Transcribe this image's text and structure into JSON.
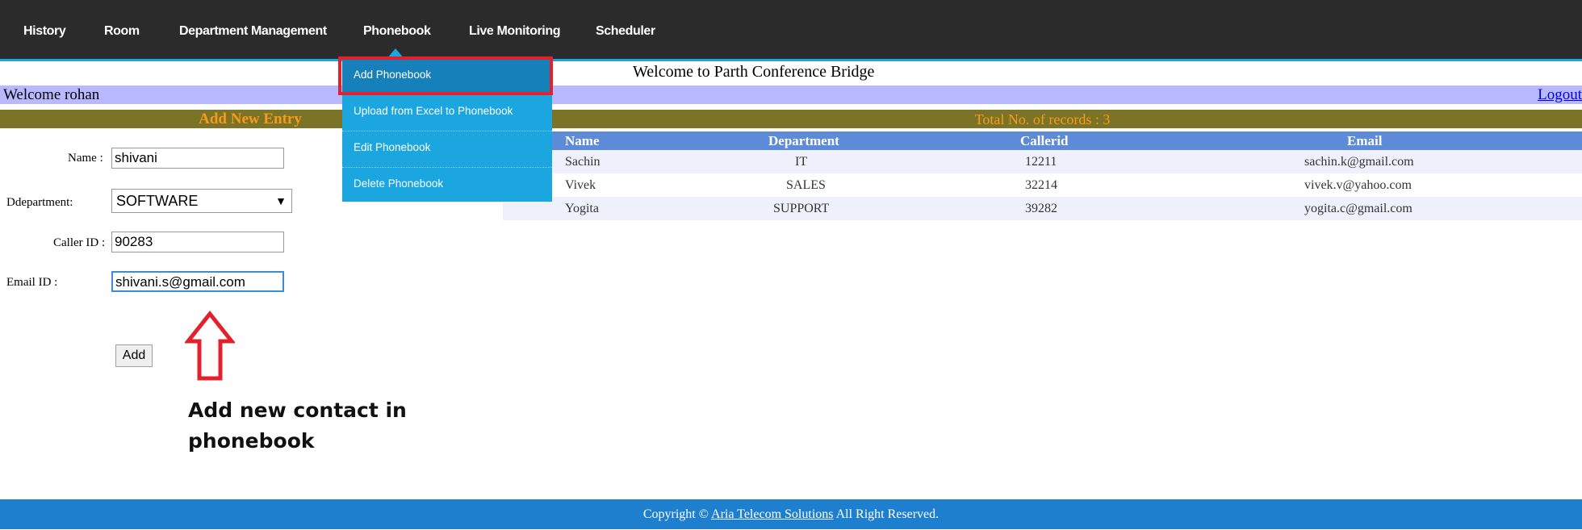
{
  "nav": {
    "items": [
      "History",
      "Room",
      "Department Management",
      "Phonebook",
      "Live Monitoring",
      "Scheduler"
    ]
  },
  "dropdown": {
    "items": [
      "Add Phonebook",
      "Upload from Excel to Phonebook",
      "Edit Phonebook",
      "Delete Phonebook"
    ]
  },
  "page_title": "Welcome to Parth Conference Bridge",
  "welcome_user": "Welcome  rohan",
  "logout": "Logout",
  "form": {
    "title": "Add New Entry",
    "name_label": "Name :",
    "name_value": "shivani",
    "department_label": "Ddepartment:",
    "department_value": "SOFTWARE",
    "callerid_label": "Caller ID :",
    "callerid_value": "90283",
    "email_label": "Email ID :",
    "email_value": "shivani.s@gmail.com",
    "add_button": "Add"
  },
  "annotation": {
    "line1": "Add new contact in",
    "line2": "phonebook"
  },
  "table": {
    "total": "Total No. of records :  3",
    "columns": [
      "Name",
      "Department",
      "Callerid",
      "Email"
    ],
    "rows": [
      [
        "Sachin",
        "IT",
        "12211",
        "sachin.k@gmail.com"
      ],
      [
        "Vivek",
        "SALES",
        "32214",
        "vivek.v@yahoo.com"
      ],
      [
        "Yogita",
        "SUPPORT",
        "39282",
        "yogita.c@gmail.com"
      ]
    ]
  },
  "footer": {
    "prefix": "Copyright © ",
    "link": "Aria Telecom Solutions",
    "suffix": " All Right Reserved."
  },
  "colors": {
    "nav_bg": "#2b2b2b",
    "accent_blue": "#1ba6df",
    "welcome_bar": "#b9b9ff",
    "olive_bar": "#7b7426",
    "orange_text": "#f99a1c",
    "table_header": "#5e8bd8",
    "footer_bg": "#1e7fcf",
    "highlight_red": "#e3212d"
  }
}
